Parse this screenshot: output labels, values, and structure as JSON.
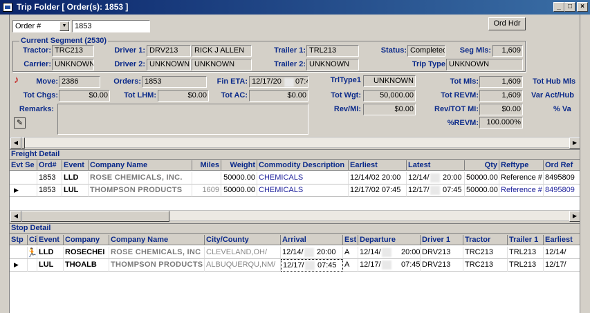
{
  "window": {
    "title": "Trip Folder [ Order(s): 1853 ]",
    "min_label": "_",
    "max_label": "□",
    "close_label": "×"
  },
  "search": {
    "type_value": "Order #",
    "number_value": "1853",
    "order_hdr_label": "Ord Hdr"
  },
  "segment": {
    "title": "Current Segment (2530)",
    "tractor_label": "Tractor:",
    "tractor": "TRC213",
    "driver1_label": "Driver 1:",
    "driver1_id": "DRV213",
    "driver1_name": "RICK J ALLEN",
    "trailer1_label": "Trailer 1:",
    "trailer1": "TRL213",
    "status_label": "Status:",
    "status": "Completed",
    "seg_mls_label": "Seg Mls:",
    "seg_mls": "1,609",
    "carrier_label": "Carrier:",
    "carrier": "UNKNOWN",
    "driver2_label": "Driver 2:",
    "driver2_id": "UNKNOWN",
    "driver2_name": "UNKNOWN",
    "trailer2_label": "Trailer 2:",
    "trailer2": "UNKNOWN",
    "trip_type_label": "Trip Type",
    "trip_type": "UNKNOWN"
  },
  "totals": {
    "move_label": "Move:",
    "move": "2386",
    "orders_label": "Orders:",
    "orders": "1853",
    "fin_eta_label": "Fin ETA:",
    "fin_eta_a": "12/17/20",
    "fin_eta_b": "07:4",
    "trltype_label": "TrlType1",
    "trltype": "UNKNOWN",
    "tot_mls_label": "Tot Mls:",
    "tot_mls": "1,609",
    "tot_hub_label": "Tot Hub Mls",
    "tot_chgs_label": "Tot Chgs:",
    "tot_chgs": "$0.00",
    "tot_lhm_label": "Tot LHM:",
    "tot_lhm": "$0.00",
    "tot_ac_label": "Tot AC:",
    "tot_ac": "$0.00",
    "tot_wgt_label": "Tot Wgt:",
    "tot_wgt": "50,000.00",
    "tot_revm_label": "Tot REVM:",
    "tot_revm": "1,609",
    "var_label": "Var Act/Hub",
    "remarks_label": "Remarks:",
    "rev_mi_label": "Rev/MI:",
    "rev_mi": "$0.00",
    "rev_tot_label": "Rev/TOT MI:",
    "rev_tot": "$0.00",
    "pct_var_label": "% Va",
    "pct_revm_label": "%REVM:",
    "pct_revm": "100.000%"
  },
  "freight": {
    "title": "Freight Detail",
    "headers": [
      "Evt Se",
      "Ord#",
      "Event",
      "Company Name",
      "Miles",
      "Weight",
      "Commodity Description",
      "Earliest",
      "Latest",
      "Qty",
      "Reftype",
      "Ord Ref"
    ],
    "rows": [
      {
        "ord": "1853",
        "event": "LLD",
        "company": "ROSE CHEMICALS, INC.",
        "miles": "",
        "weight": "50000.00",
        "commodity": "CHEMICALS",
        "earliest": "12/14/02 20:00",
        "latest_a": "12/14/",
        "latest_b": "20:00",
        "qty": "50000.00",
        "reftype": "Reference #",
        "ordref": "8495809"
      },
      {
        "ord": "1853",
        "event": "LUL",
        "company": "THOMPSON PRODUCTS",
        "miles": "1609",
        "weight": "50000.00",
        "commodity": "CHEMICALS",
        "earliest": "12/17/02 07:45",
        "latest_a": "12/17/",
        "latest_b": "07:45",
        "qty": "50000.00",
        "reftype": "Reference #",
        "ordref": "8495809"
      }
    ]
  },
  "stops": {
    "title": "Stop Detail",
    "headers": [
      "Stp",
      "Ci",
      "Event",
      "Company",
      "Company Name",
      "City/County",
      "Arrival",
      "Est",
      "Departure",
      "Driver 1",
      "Tractor",
      "Trailer 1",
      "Earliest"
    ],
    "rows": [
      {
        "event": "LLD",
        "company": "ROSECHEI",
        "company_name": "ROSE CHEMICALS, INC",
        "city": "CLEVELAND,OH/",
        "arr_a": "12/14/",
        "arr_b": "20:00",
        "est": "A",
        "dep_a": "12/14/",
        "dep_b": "20:00",
        "driver": "DRV213",
        "tractor": "TRC213",
        "trailer": "TRL213",
        "earliest": "12/14/"
      },
      {
        "event": "LUL",
        "company": "THOALB",
        "company_name": "THOMPSON PRODUCTS",
        "city": "ALBUQUERQU,NM/",
        "arr_a": "12/17/",
        "arr_b": "07:45",
        "est": "A",
        "dep_a": "12/17/",
        "dep_b": "07:45",
        "driver": "DRV213",
        "tractor": "TRC213",
        "trailer": "TRL213",
        "earliest": "12/17/"
      }
    ]
  }
}
